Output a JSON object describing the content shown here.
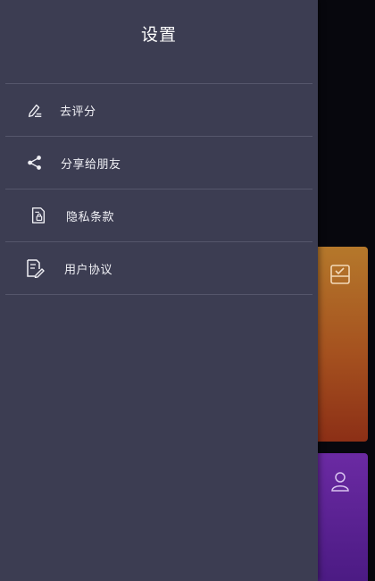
{
  "drawer": {
    "title": "设置",
    "items": [
      {
        "id": "rate",
        "label": "去评分",
        "icon": "rate-pen-icon"
      },
      {
        "id": "share",
        "label": "分享给朋友",
        "icon": "share-icon"
      },
      {
        "id": "privacy",
        "label": "隐私条款",
        "icon": "privacy-document-icon"
      },
      {
        "id": "agreement",
        "label": "用户协议",
        "icon": "agreement-document-icon"
      }
    ]
  },
  "colors": {
    "drawer_bg": "#3c3d52",
    "divider": "#55566b",
    "text": "#f0f0f5",
    "card_orange": "#a5511f",
    "card_purple": "#4a1a82"
  }
}
